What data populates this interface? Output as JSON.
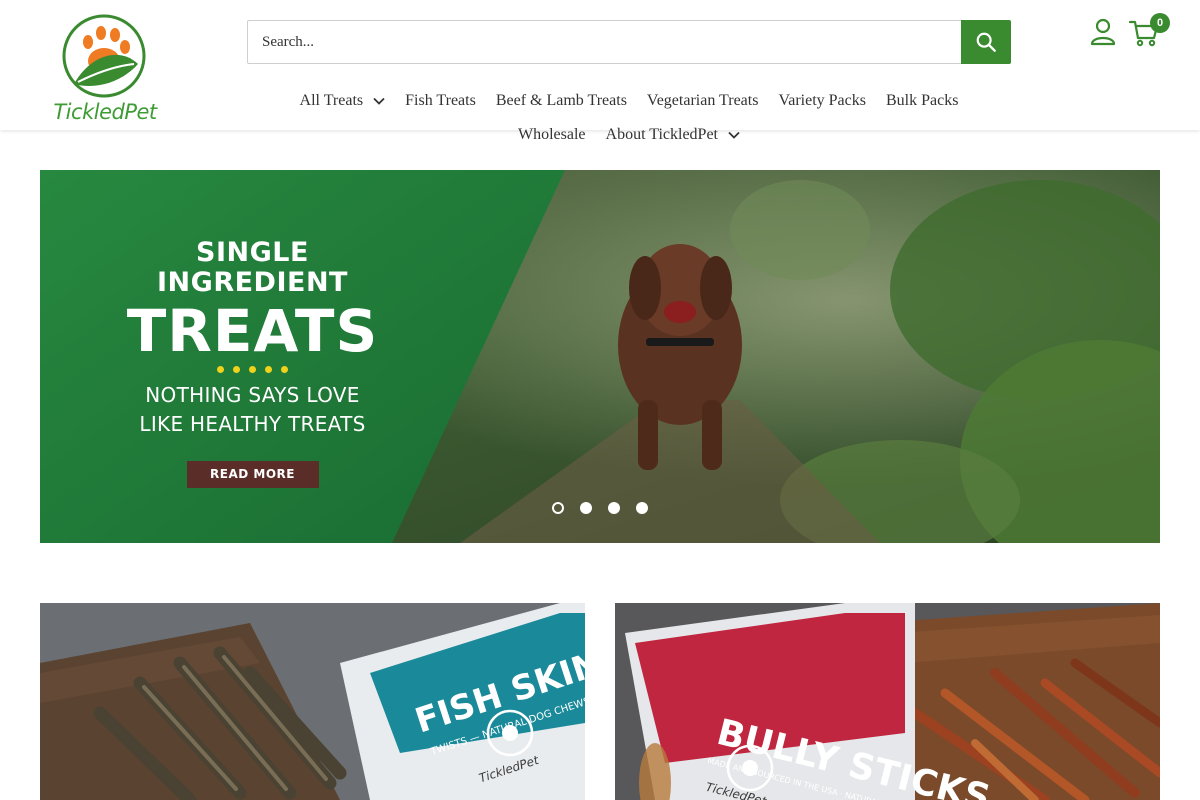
{
  "brand": {
    "logo_text": "TickledPet"
  },
  "search": {
    "placeholder": "Search..."
  },
  "header": {
    "cart_count": "0"
  },
  "nav": {
    "row1": [
      {
        "label": "All Treats",
        "has_dropdown": true
      },
      {
        "label": "Fish Treats",
        "has_dropdown": false
      },
      {
        "label": "Beef & Lamb Treats",
        "has_dropdown": false
      },
      {
        "label": "Vegetarian Treats",
        "has_dropdown": false
      },
      {
        "label": "Variety Packs",
        "has_dropdown": false
      },
      {
        "label": "Bulk Packs",
        "has_dropdown": false
      }
    ],
    "row2": [
      {
        "label": "Wholesale",
        "has_dropdown": false
      },
      {
        "label": "About TickledPet",
        "has_dropdown": true
      }
    ]
  },
  "hero": {
    "kicker": "SINGLE INGREDIENT",
    "headline": "TREATS",
    "tagline_1": "NOTHING SAYS LOVE",
    "tagline_2": "LIKE HEALTHY TREATS",
    "cta": "READ MORE",
    "slide_count": 4,
    "active_slide": 1
  },
  "tiles": [
    {
      "package_title": "FISH SKIN",
      "package_subtitle": "TWISTS — NATURAL DOG CHEWS",
      "package_brand": "TickledPet"
    },
    {
      "package_title": "BULLY STICKS",
      "package_subtitle": "MADE AND SOURCED IN THE USA · NATURAL DOG TREATS",
      "package_brand": "TickledPet"
    }
  ],
  "colors": {
    "brand_green": "#3a8a30",
    "logo_orange": "#ef7b22",
    "hero_green": "#1f7d3a",
    "cta_brown": "#5a2d28",
    "accent_yellow": "#f1d21a",
    "fish_pkg_teal": "#1a8a9a",
    "bully_pkg_red": "#c0263f"
  },
  "icons": {
    "search": "search-icon",
    "account": "user-icon",
    "cart": "cart-icon",
    "dropdown": "chevron-down-icon"
  }
}
